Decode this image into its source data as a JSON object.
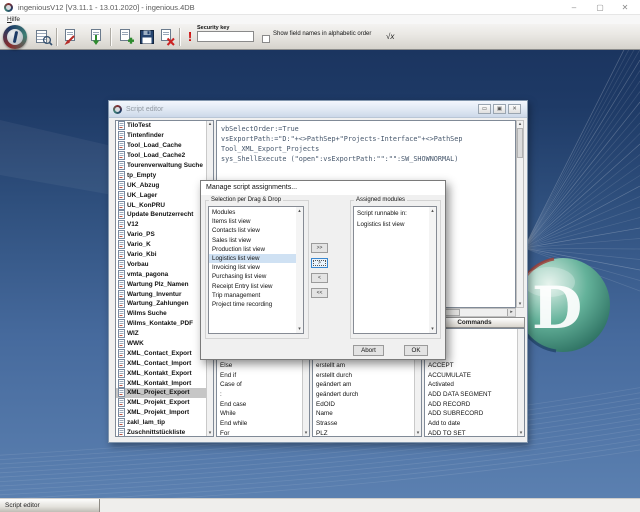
{
  "window": {
    "title": "ingeniousV12 [V3.11.1 - 13.01.2020] - ingenious.4DB"
  },
  "window_controls": {
    "minimize": "–",
    "maximize": "▢",
    "close": "✕"
  },
  "menu": {
    "hilfe_accel": "H",
    "hilfe_rest": "ilfe"
  },
  "toolbar": {
    "security_key_label": "Security key",
    "security_key_value": "",
    "alphabetic_checkbox_label": "Show field names in alphabetic order",
    "alphabetic_checkbox_checked": false,
    "formula_icon_label": "√x",
    "execute_label": "!"
  },
  "background": {
    "logo_letter": "D"
  },
  "script_editor": {
    "title": "Script editor",
    "window_controls": {
      "minimize": "▭",
      "maximize": "▣",
      "close": "✕"
    },
    "selected_script": "XML_Project_Export",
    "scripts": [
      "TiloTest",
      "Tintenfinder",
      "Tool_Load_Cache",
      "Tool_Load_Cache2",
      "Tourenverwaltung Suche",
      "tp_Empty",
      "UK_Abzug",
      "UK_Lager",
      "UL_KonPRU",
      "Update Benutzerrecht",
      "V12",
      "Vario_PS",
      "Vario_K",
      "Vario_Kbi",
      "Vorbau",
      "vmta_pagona",
      "Wartung Plz_Namen",
      "Wartung_Inventur",
      "Wartung_Zahlungen",
      "Wilms Suche",
      "Wilms_Kontakte_PDF",
      "WIZ",
      "WWK",
      "XML_Contact_Export",
      "XML_Contact_Import",
      "XML_Kontakt_Export",
      "XML_Kontakt_Import",
      "XML_Project_Export",
      "XML_Projekt_Export",
      "XML_Projekt_Import",
      "zakl_lam_tip",
      "Zuschnittstückliste"
    ],
    "code_lines": [
      "vbSelectOrder:=True",
      "vsExportPath:=\"D:\"+<>PathSep+\"Projects-Interface\"+<>PathSep",
      "Tool_XML_Export_Projects",
      "sys_ShellExecute (\"open\":vsExportPath:\"\":\"\":SW_SHOWNORMAL)"
    ],
    "commands_header": "Commands",
    "keywords": [
      "Else",
      "End if",
      "Case of",
      ":",
      "End case",
      "While",
      "End while",
      "For"
    ],
    "fields": [
      "erstellt am",
      "erstellt durch",
      "geändert am",
      "geändert durch",
      "EdOID",
      "Name",
      "Strasse",
      "PLZ"
    ],
    "commands": [
      "ACCEPT",
      "ACCUMULATE",
      "Activated",
      "ADD DATA SEGMENT",
      "ADD RECORD",
      "ADD SUBRECORD",
      "Add to date",
      "ADD TO SET"
    ]
  },
  "dialog": {
    "title": "Manage script assignments...",
    "selection_group_label": "Selection per Drag & Drop",
    "assigned_group_label": "Assigned modules",
    "selection_items": [
      "Modules",
      "Items list view",
      "Contacts list view",
      "Sales list view",
      "Production list view",
      "Logistics list view",
      "Invoicing list view",
      "Purchasing list view",
      "Receipt Entry list view",
      "Trip management",
      "Project time recording"
    ],
    "selected_item": "Logistics list view",
    "assigned_items": [
      "Script runnable in:",
      "Logistics list view"
    ],
    "transfer_buttons": [
      ">>",
      ">",
      "<",
      "<<"
    ],
    "focused_transfer_button": ">",
    "abort_label": "Abort",
    "ok_label": "OK"
  },
  "taskbar": {
    "active_tab_label": "Script editor"
  },
  "scroll_icons": {
    "up": "▴",
    "down": "▾",
    "right": "▸"
  }
}
